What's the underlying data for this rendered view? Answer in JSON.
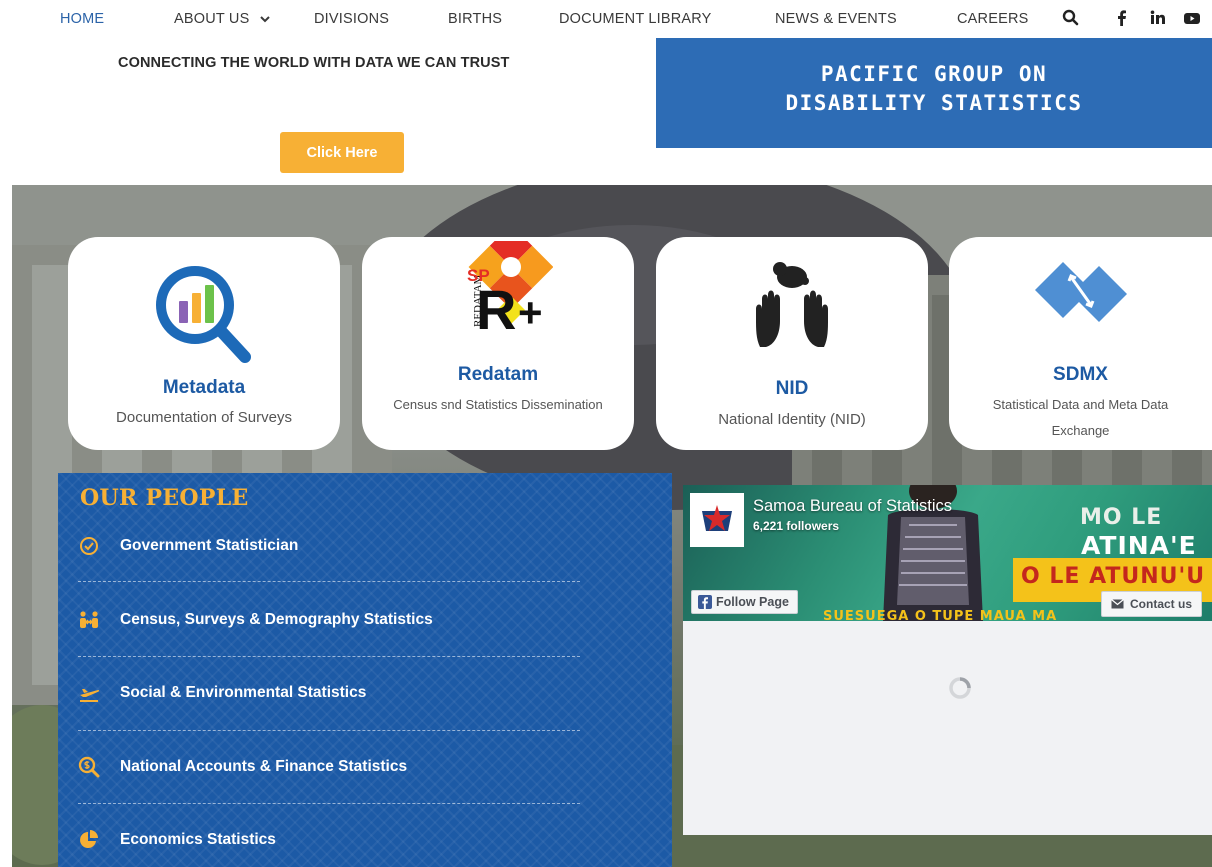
{
  "nav": {
    "items": [
      {
        "label": "HOME",
        "active": true
      },
      {
        "label": "ABOUT US",
        "has_dropdown": true
      },
      {
        "label": "DIVISIONS"
      },
      {
        "label": "BIRTHS"
      },
      {
        "label": "DOCUMENT LIBRARY"
      },
      {
        "label": "NEWS & EVENTS"
      },
      {
        "label": "CAREERS"
      }
    ],
    "icons": [
      "search-icon",
      "facebook-icon",
      "linkedin-icon",
      "youtube-icon"
    ]
  },
  "hero": {
    "tagline": "CONNECTING THE WORLD WITH DATA WE CAN TRUST",
    "button_label": "Click Here",
    "banner_line1": "PACIFIC GROUP ON",
    "banner_line2": "DISABILITY STATISTICS"
  },
  "cards": [
    {
      "title": "Metadata",
      "description": "Documentation of Surveys",
      "icon": "magnifier-chart-icon"
    },
    {
      "title": "Redatam",
      "description": "Census snd Statistics Dissemination",
      "icon": "redatam-logo",
      "logo_text": "SP",
      "logo_side": "REDATAM"
    },
    {
      "title": "NID",
      "description": "National Identity (NID)",
      "icon": "hands-baby-icon"
    },
    {
      "title": "SDMX",
      "description": "Statistical Data and Meta Data Exchange",
      "icon": "sdmx-logo"
    }
  ],
  "people": {
    "title": "OUR PEOPLE",
    "items": [
      {
        "label": "Government Statistician",
        "icon": "check-circle-icon"
      },
      {
        "label": "Census, Surveys & Demography Statistics",
        "icon": "people-icon"
      },
      {
        "label": "Social & Environmental Statistics",
        "icon": "plane-icon"
      },
      {
        "label": "National Accounts & Finance Statistics",
        "icon": "search-dollar-icon"
      },
      {
        "label": "Economics Statistics",
        "icon": "pie-chart-icon"
      }
    ]
  },
  "facebook": {
    "page_name": "Samoa Bureau of Statistics",
    "followers": "6,221 followers",
    "follow_label": "Follow Page",
    "contact_label": "Contact us",
    "cover_lines": [
      "MO LE",
      "ATINA'E",
      "O LE ATUNU'U",
      "SUESUEGA O TUPE MAUA MA"
    ]
  },
  "colors": {
    "brand_blue": "#2d6cb5",
    "accent_orange": "#f7b035",
    "people_bg": "#1c5aa6"
  }
}
